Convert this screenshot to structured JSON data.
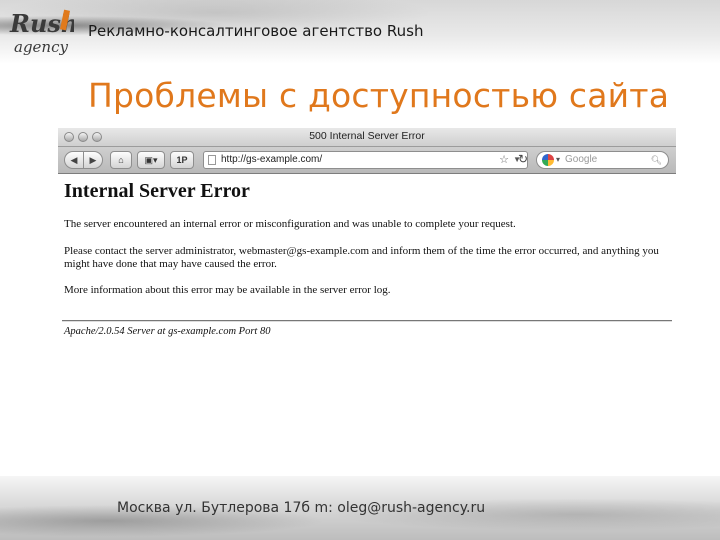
{
  "header": {
    "agency_text": "Рекламно-консалтинговое агентство Rush",
    "logo_word_top": "Rush",
    "logo_word_bottom": "agency"
  },
  "slide": {
    "title": "Проблемы с доступностью сайта"
  },
  "footer": {
    "contact_text": "Москва ул. Бутлерова 17б  m: oleg@rush-agency.ru"
  },
  "browser": {
    "window_title": "500 Internal Server Error",
    "toolbar": {
      "back_icon": "back-arrow-icon",
      "forward_icon": "forward-arrow-icon",
      "home_icon": "home-icon",
      "bookmarks_icon": "bookmarks-icon",
      "onep_label": "1P"
    },
    "address_bar": {
      "url": "http://gs-example.com/"
    },
    "search_bar": {
      "placeholder": "Google"
    },
    "page": {
      "heading": "Internal Server Error",
      "para1": "The server encountered an internal error or misconfiguration and was unable to complete your request.",
      "para2": "Please contact the server administrator, webmaster@gs-example.com and inform them of the time the error occurred, and anything you might have done that may have caused the error.",
      "para3": "More information about this error may be available in the server error log.",
      "server_signature": "Apache/2.0.54 Server at gs-example.com Port 80"
    }
  },
  "colors": {
    "title_orange": "#e0781c"
  }
}
